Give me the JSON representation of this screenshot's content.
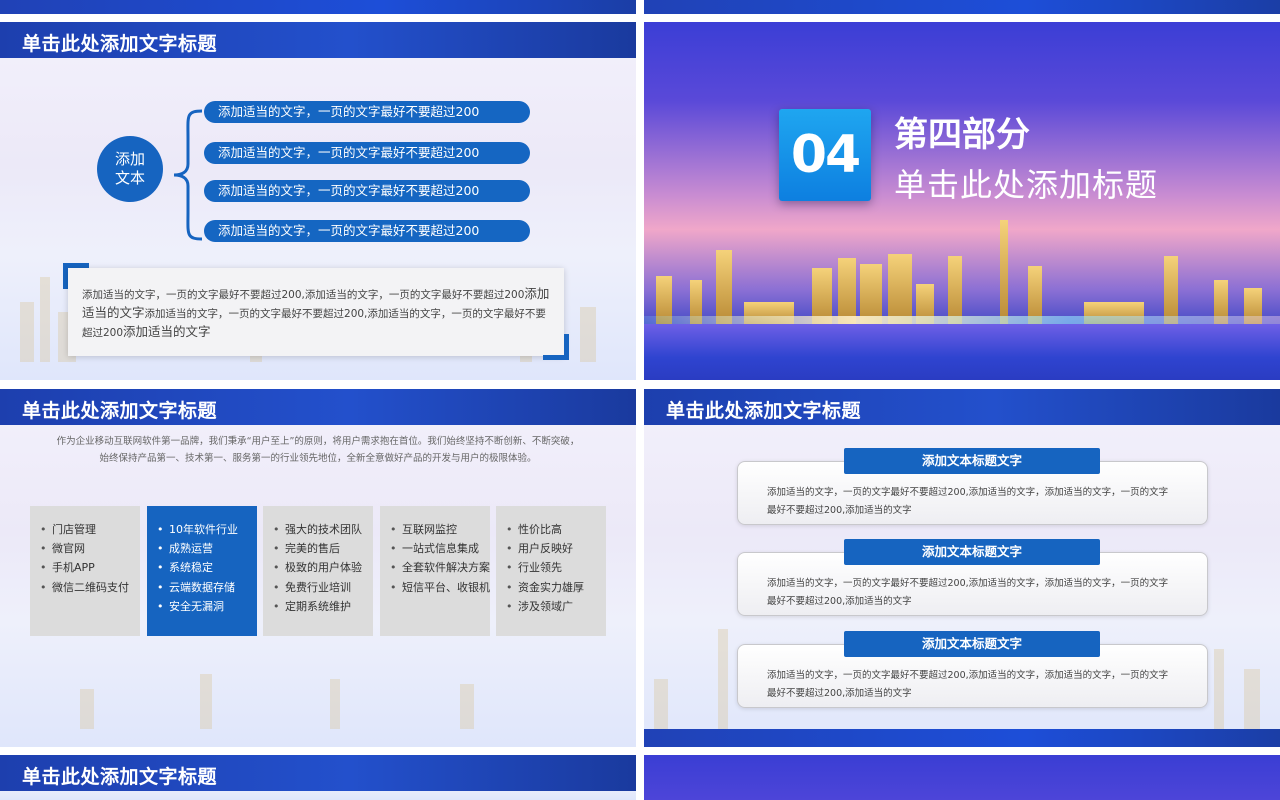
{
  "slide1": {
    "title": "单击此处添加文字标题",
    "circle_label_line1": "添加",
    "circle_label_line2": "文本",
    "pills": [
      "添加适当的文字，一页的文字最好不要超过200",
      "添加适当的文字，一页的文字最好不要超过200",
      "添加适当的文字，一页的文字最好不要超过200",
      "添加适当的文字，一页的文字最好不要超过200"
    ],
    "box_part1": "添加适当的文字，一页的文字最好不要超过200,添加适当的文字，一页的文字最好不要超过200",
    "box_part2": "添加适当的文字",
    "box_part3": "添加适当的文字，一页的文字最好不要超过200,添加适当的文字，一页的文字最好不要超过200",
    "box_part4": "添加适当的文字"
  },
  "slide2": {
    "number": "04",
    "part_title": "第四部分",
    "subtitle": "单击此处添加标题"
  },
  "slide3": {
    "title": "单击此处添加文字标题",
    "intro_line1": "作为企业移动互联网软件第一品牌，我们秉承“用户至上”的原则，将用户需求抱在首位。我们始终坚持不断创新、不断突破，",
    "intro_line2": "始终保持产品第一、技术第一、服务第一的行业领先地位，全新全意做好产品的开发与用户的极限体验。",
    "columns": [
      [
        "门店管理",
        "微官网",
        "手机APP",
        "微信二维码支付"
      ],
      [
        "10年软件行业",
        "成熟运营",
        "系统稳定",
        "云端数据存储",
        "安全无漏洞"
      ],
      [
        "强大的技术团队",
        "完美的售后",
        "极致的用户体验",
        "免费行业培训",
        "定期系统维护"
      ],
      [
        "互联网监控",
        "一站式信息集成",
        "全套软件解决方案",
        "短信平台、收银机"
      ],
      [
        "性价比高",
        "用户反映好",
        "行业领先",
        "资金实力雄厚",
        "涉及领域广"
      ]
    ]
  },
  "slide4": {
    "title": "单击此处添加文字标题",
    "cards": [
      {
        "head": "添加文本标题文字",
        "line1": "添加适当的文字，一页的文字最好不要超过200,添加适当的文字，添加适当的文字，一页的文字",
        "line2": "最好不要超过200,添加适当的文字"
      },
      {
        "head": "添加文本标题文字",
        "line1": "添加适当的文字，一页的文字最好不要超过200,添加适当的文字，添加适当的文字，一页的文字",
        "line2": "最好不要超过200,添加适当的文字"
      },
      {
        "head": "添加文本标题文字",
        "line1": "添加适当的文字，一页的文字最好不要超过200,添加适当的文字，添加适当的文字，一页的文字",
        "line2": "最好不要超过200,添加适当的文字"
      }
    ]
  },
  "slide5": {
    "title": "单击此处添加文字标题"
  }
}
